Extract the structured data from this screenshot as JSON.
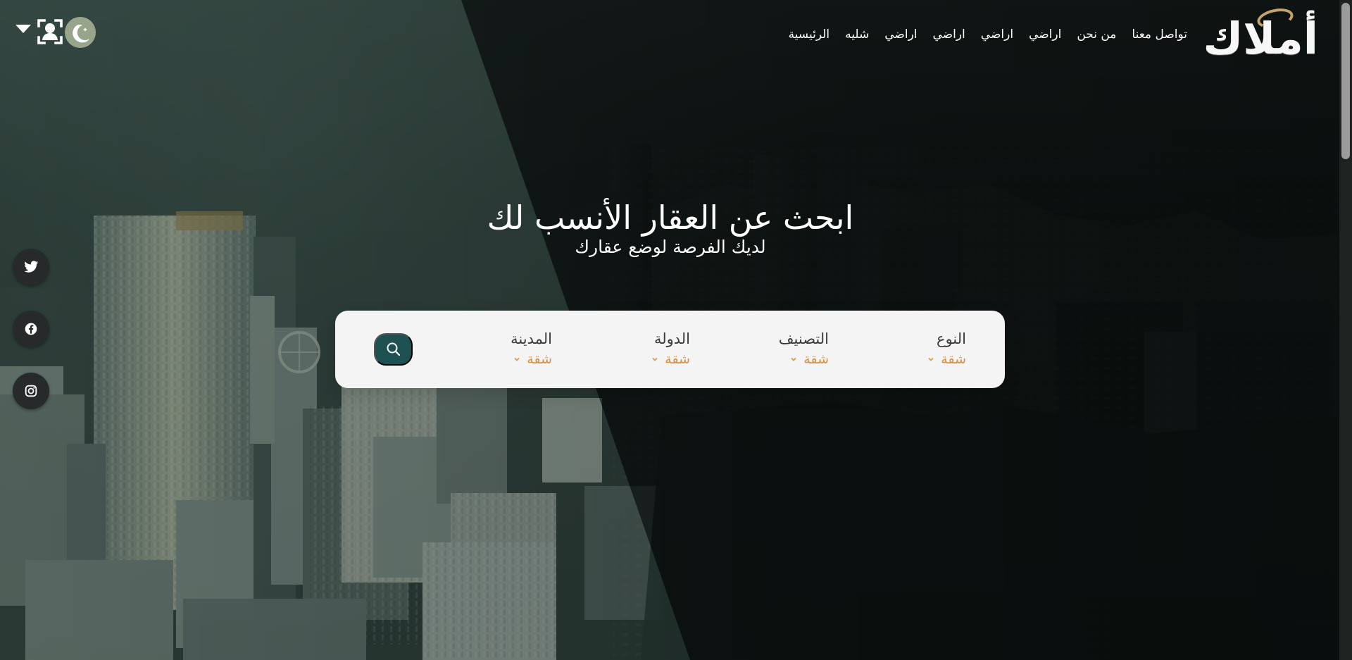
{
  "header": {
    "logo_text": "أملاك",
    "nav": [
      {
        "label": "الرئيسية"
      },
      {
        "label": "شليه"
      },
      {
        "label": "اراضي"
      },
      {
        "label": "اراضي"
      },
      {
        "label": "اراضي"
      },
      {
        "label": "اراضي"
      },
      {
        "label": "من نحن"
      },
      {
        "label": "تواصل معنا"
      }
    ],
    "icons": {
      "dropdown": "chevron-down-icon",
      "profile": "user-scan-icon",
      "theme": "moon-icon"
    }
  },
  "hero": {
    "title": "ابحث عن العقار الأنسب لك",
    "subtitle": "لديك الفرصة لوضع عقارك"
  },
  "search": {
    "filters": [
      {
        "label": "النوع",
        "value": "شقة"
      },
      {
        "label": "التصنيف",
        "value": "شقة"
      },
      {
        "label": "الدولة",
        "value": "شقة"
      },
      {
        "label": "المدينة",
        "value": "شقة"
      }
    ],
    "button_icon": "search-icon"
  },
  "social": [
    {
      "name": "twitter",
      "icon": "twitter-icon"
    },
    {
      "name": "facebook",
      "icon": "facebook-icon"
    },
    {
      "name": "instagram",
      "icon": "instagram-icon"
    }
  ],
  "colors": {
    "accent": "#d89045",
    "search_button": "#1e5151",
    "theme_button": "#99a58a",
    "panel": "#f4f4f4",
    "nav_text": "#ffffff"
  }
}
